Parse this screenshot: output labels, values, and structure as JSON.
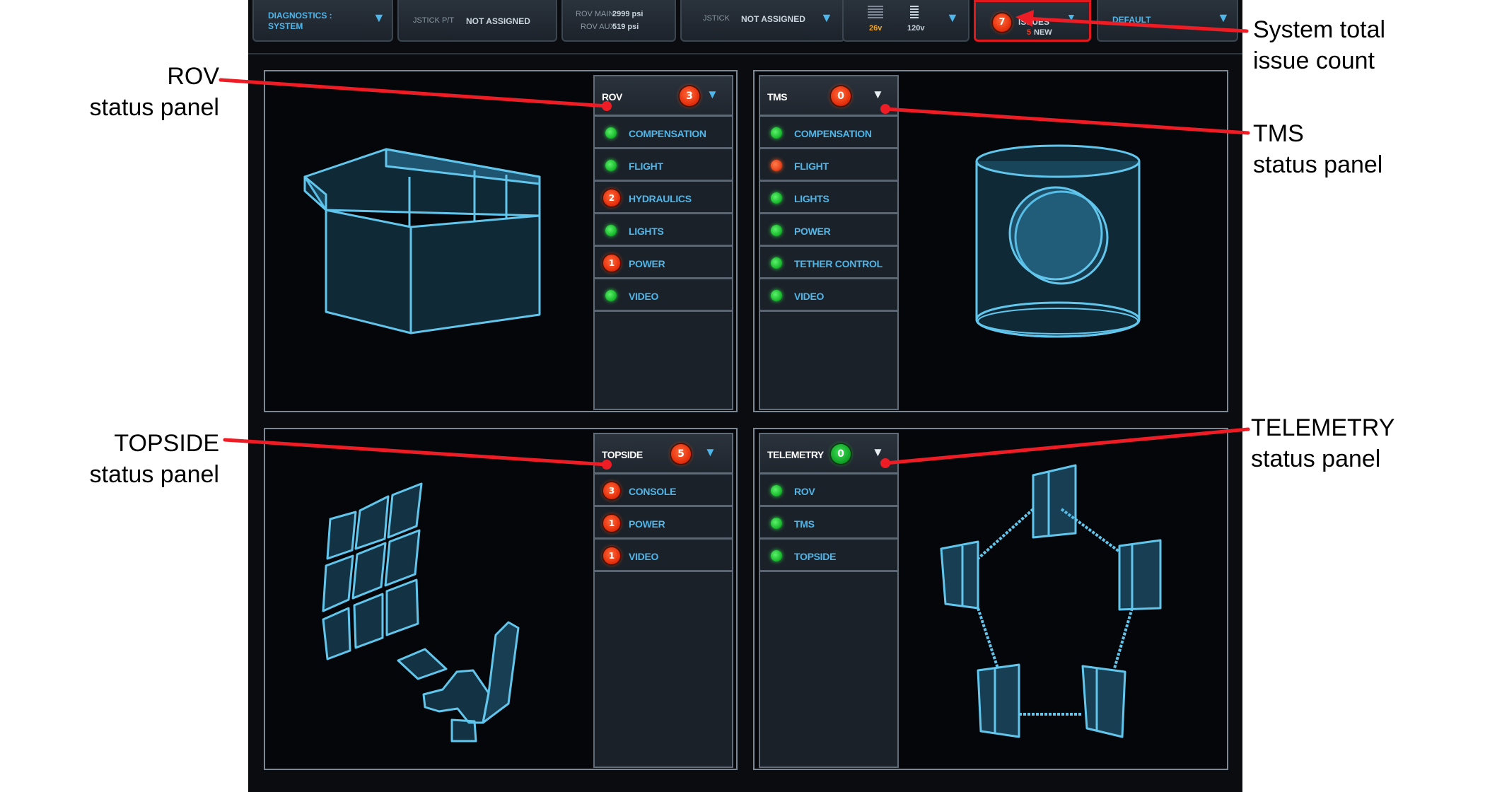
{
  "topbar": {
    "diagnostics_label": "DIAGNOSTICS :",
    "diagnostics_value": "SYSTEM",
    "jstick_pt_label": "JSTICK P/T",
    "jstick_pt_value": "NOT ASSIGNED",
    "rov_main_label": "ROV MAIN",
    "rov_main_value": "2999 psi",
    "rov_aux_label": "ROV AUX",
    "rov_aux_value": "519 psi",
    "jstick_label": "JSTICK",
    "jstick_value": "NOT ASSIGNED",
    "volt_1": "26v",
    "volt_2": "120v",
    "issues_count": "7",
    "issues_label": "ISSUES",
    "issues_new_count": "5",
    "issues_new_label": "NEW",
    "preset": "DEFAULT"
  },
  "panels": {
    "rov": {
      "title": "ROV",
      "count": "3",
      "items": [
        {
          "label": "COMPENSATION",
          "status": "ok"
        },
        {
          "label": "FLIGHT",
          "status": "ok"
        },
        {
          "label": "HYDRAULICS",
          "status": "issue",
          "count": "2"
        },
        {
          "label": "LIGHTS",
          "status": "ok"
        },
        {
          "label": "POWER",
          "status": "issue",
          "count": "1"
        },
        {
          "label": "VIDEO",
          "status": "ok"
        }
      ]
    },
    "tms": {
      "title": "TMS",
      "count": "0",
      "items": [
        {
          "label": "COMPENSATION",
          "status": "ok"
        },
        {
          "label": "FLIGHT",
          "status": "alert"
        },
        {
          "label": "LIGHTS",
          "status": "ok"
        },
        {
          "label": "POWER",
          "status": "ok"
        },
        {
          "label": "TETHER CONTROL",
          "status": "ok"
        },
        {
          "label": "VIDEO",
          "status": "ok"
        }
      ]
    },
    "topside": {
      "title": "TOPSIDE",
      "count": "5",
      "items": [
        {
          "label": "CONSOLE",
          "status": "issue",
          "count": "3"
        },
        {
          "label": "POWER",
          "status": "issue",
          "count": "1"
        },
        {
          "label": "VIDEO",
          "status": "issue",
          "count": "1"
        }
      ]
    },
    "telemetry": {
      "title": "TELEMETRY",
      "count": "0",
      "items": [
        {
          "label": "ROV",
          "status": "ok"
        },
        {
          "label": "TMS",
          "status": "ok"
        },
        {
          "label": "TOPSIDE",
          "status": "ok"
        }
      ]
    }
  },
  "annotations": {
    "rov_line1": "ROV",
    "rov_line2": "status panel",
    "topside_line1": "TOPSIDE",
    "topside_line2": "status panel",
    "system_line1": "System total",
    "system_line2": "issue count",
    "tms_line1": "TMS",
    "tms_line2": "status panel",
    "telemetry_line1": "TELEMETRY",
    "telemetry_line2": "status panel"
  },
  "colors": {
    "accent": "#4fb6ea",
    "alert_red": "#e3181d",
    "ok_green": "#18b82c",
    "wireframe": "#62c6ec"
  }
}
